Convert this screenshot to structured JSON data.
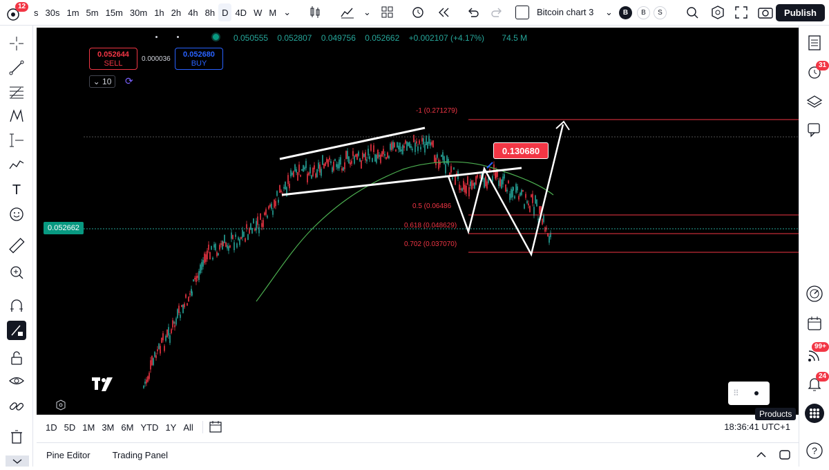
{
  "topbar": {
    "logo_badge": "12",
    "intervals": [
      "s",
      "30s",
      "1m",
      "5m",
      "15m",
      "30m",
      "1h",
      "2h",
      "4h",
      "8h",
      "D",
      "4D",
      "W",
      "M"
    ],
    "active_interval": "D",
    "layout_name": "Bitcoin chart 3",
    "account_b": "B",
    "account_b2": "B",
    "account_s": "S",
    "publish_label": "Publish"
  },
  "legend": {
    "open": "0.050555",
    "high": "0.052807",
    "low": "0.049756",
    "close": "0.052662",
    "change": "+0.002107 (+4.17%)",
    "volume": "74.5 M"
  },
  "trade": {
    "sell_price": "0.052644",
    "sell_label": "SELL",
    "spread": "0.000036",
    "buy_price": "0.052680",
    "buy_label": "BUY",
    "quantity": "10"
  },
  "chart": {
    "last_price_tag": "0.052662",
    "target_label": "0.130680",
    "fib_levels": [
      {
        "label": "-1 (0.271279)"
      },
      {
        "label": "0.5 (0.06486"
      },
      {
        "label": "0.618 (0.048629)"
      },
      {
        "label": "0.702 (0.037070)"
      }
    ],
    "colors": {
      "bull": "#26a69a",
      "bear": "#f23645",
      "ma": "#4caf50",
      "background": "#000000"
    }
  },
  "bottombar": {
    "ranges": [
      "1D",
      "5D",
      "1M",
      "3M",
      "6M",
      "YTD",
      "1Y",
      "All"
    ],
    "time": "18:36:41 UTC+1"
  },
  "footer": {
    "pine_editor": "Pine Editor",
    "trading_panel": "Trading Panel"
  },
  "rightbar": {
    "alerts_badge": "31",
    "notifications_badge": "99+",
    "chats_badge": "24",
    "products_label": "Products"
  }
}
